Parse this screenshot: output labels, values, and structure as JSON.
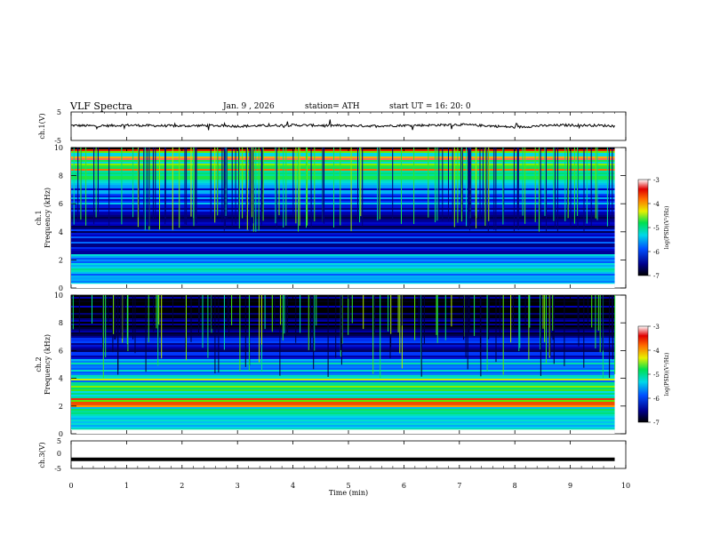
{
  "header": {
    "title": "VLF  Spectra",
    "date": "Jan.  9  , 2026",
    "station": "station= ATH",
    "start": "start  UT  =    16: 20: 0"
  },
  "chart_data": [
    {
      "type": "line",
      "panel": "ch1-waveform",
      "ylabel": "ch.1(V)",
      "ylim": [
        -5,
        5
      ],
      "yticks": [
        "5",
        "-5"
      ],
      "xlim": [
        0,
        10
      ],
      "x": [
        0,
        0.5,
        1,
        1.5,
        2,
        2.5,
        3,
        3.5,
        4,
        4.5,
        5,
        5.5,
        6,
        6.5,
        7,
        7.5,
        8,
        8.5,
        9,
        9.5,
        9.8
      ],
      "y": [
        0.3,
        0.1,
        0.4,
        0.2,
        0.1,
        0.3,
        0.0,
        0.2,
        0.4,
        0.3,
        0.2,
        0.1,
        0.3,
        0.4,
        0.6,
        0.2,
        -0.4,
        0.2,
        0.4,
        0.3,
        0.1
      ],
      "color": "#000000"
    },
    {
      "type": "heatmap",
      "panel": "ch1-spectrogram",
      "ylabel_line1": "ch.1",
      "ylabel_line2": "Frequency  (kHz)",
      "ylim": [
        0,
        10
      ],
      "yticks": [
        "0",
        "2",
        "4",
        "6",
        "8",
        "10"
      ],
      "xlim": [
        0,
        9.8
      ],
      "colorbar": {
        "label": "log(PSD)(V²/Hz)",
        "range": [
          -7,
          -3
        ],
        "ticks": [
          "-3",
          "-4",
          "-5",
          "-6",
          "-7"
        ]
      },
      "bands": [
        {
          "f0": 0.0,
          "f1": 0.3,
          "level": 0.0
        },
        {
          "f0": 0.3,
          "f1": 1.0,
          "level": 0.35
        },
        {
          "f0": 1.0,
          "f1": 2.5,
          "level": 0.42
        },
        {
          "f0": 2.5,
          "f1": 4.0,
          "level": 0.22
        },
        {
          "f0": 4.0,
          "f1": 6.0,
          "level": 0.16
        },
        {
          "f0": 6.0,
          "f1": 7.5,
          "level": 0.3
        },
        {
          "f0": 7.5,
          "f1": 10.0,
          "level": 0.58
        }
      ]
    },
    {
      "type": "heatmap",
      "panel": "ch2-spectrogram",
      "ylabel_line1": "ch.2",
      "ylabel_line2": "Frequency  (kHz)",
      "ylim": [
        0,
        10
      ],
      "yticks": [
        "0",
        "2",
        "4",
        "6",
        "8",
        "10"
      ],
      "xlim": [
        0,
        9.8
      ],
      "colorbar": {
        "label": "log(PSD)(V²/Hz)",
        "range": [
          -7,
          -3
        ],
        "ticks": [
          "-3",
          "-4",
          "-5",
          "-6",
          "-7"
        ]
      },
      "bands": [
        {
          "f0": 0.0,
          "f1": 0.3,
          "level": 0.0
        },
        {
          "f0": 0.3,
          "f1": 2.0,
          "level": 0.5
        },
        {
          "f0": 2.0,
          "f1": 2.3,
          "level": 0.75
        },
        {
          "f0": 2.3,
          "f1": 3.8,
          "level": 0.55
        },
        {
          "f0": 3.8,
          "f1": 5.5,
          "level": 0.4
        },
        {
          "f0": 5.5,
          "f1": 7.0,
          "level": 0.2
        },
        {
          "f0": 7.0,
          "f1": 10.0,
          "level": 0.06
        }
      ]
    },
    {
      "type": "line",
      "panel": "ch3-waveform",
      "ylabel": "ch.3(V)",
      "ylim": [
        -5,
        5
      ],
      "yticks": [
        "5",
        "0",
        "-5"
      ],
      "xlim": [
        0,
        10
      ],
      "x": [
        0,
        9.8
      ],
      "y": [
        -1.9,
        -1.9
      ],
      "color": "#000000",
      "xlabel": "Time  (min)",
      "xticks": [
        "0",
        "1",
        "2",
        "3",
        "4",
        "5",
        "6",
        "7",
        "8",
        "9",
        "10"
      ]
    }
  ]
}
